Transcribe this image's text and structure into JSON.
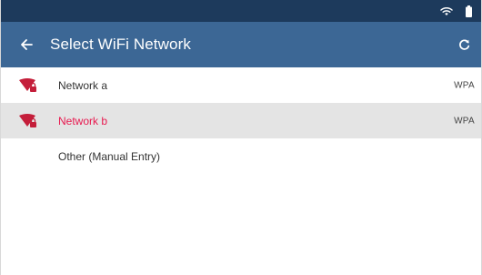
{
  "status_bar": {
    "icons": [
      "wifi-icon",
      "battery-icon"
    ],
    "background": "#1d3a5c"
  },
  "app_bar": {
    "back_icon": "arrow-left-icon",
    "title": "Select WiFi Network",
    "refresh_icon": "refresh-icon",
    "background": "#3c6795"
  },
  "networks": [
    {
      "name": "Network a",
      "security": "WPA",
      "locked": true,
      "selected": false
    },
    {
      "name": "Network b",
      "security": "WPA",
      "locked": true,
      "selected": true
    }
  ],
  "manual_entry": {
    "label": "Other (Manual Entry)"
  },
  "colors": {
    "selected_text": "#e8194f",
    "selected_row": "#e4e4e4",
    "signal_icon": "#c41e3a"
  }
}
